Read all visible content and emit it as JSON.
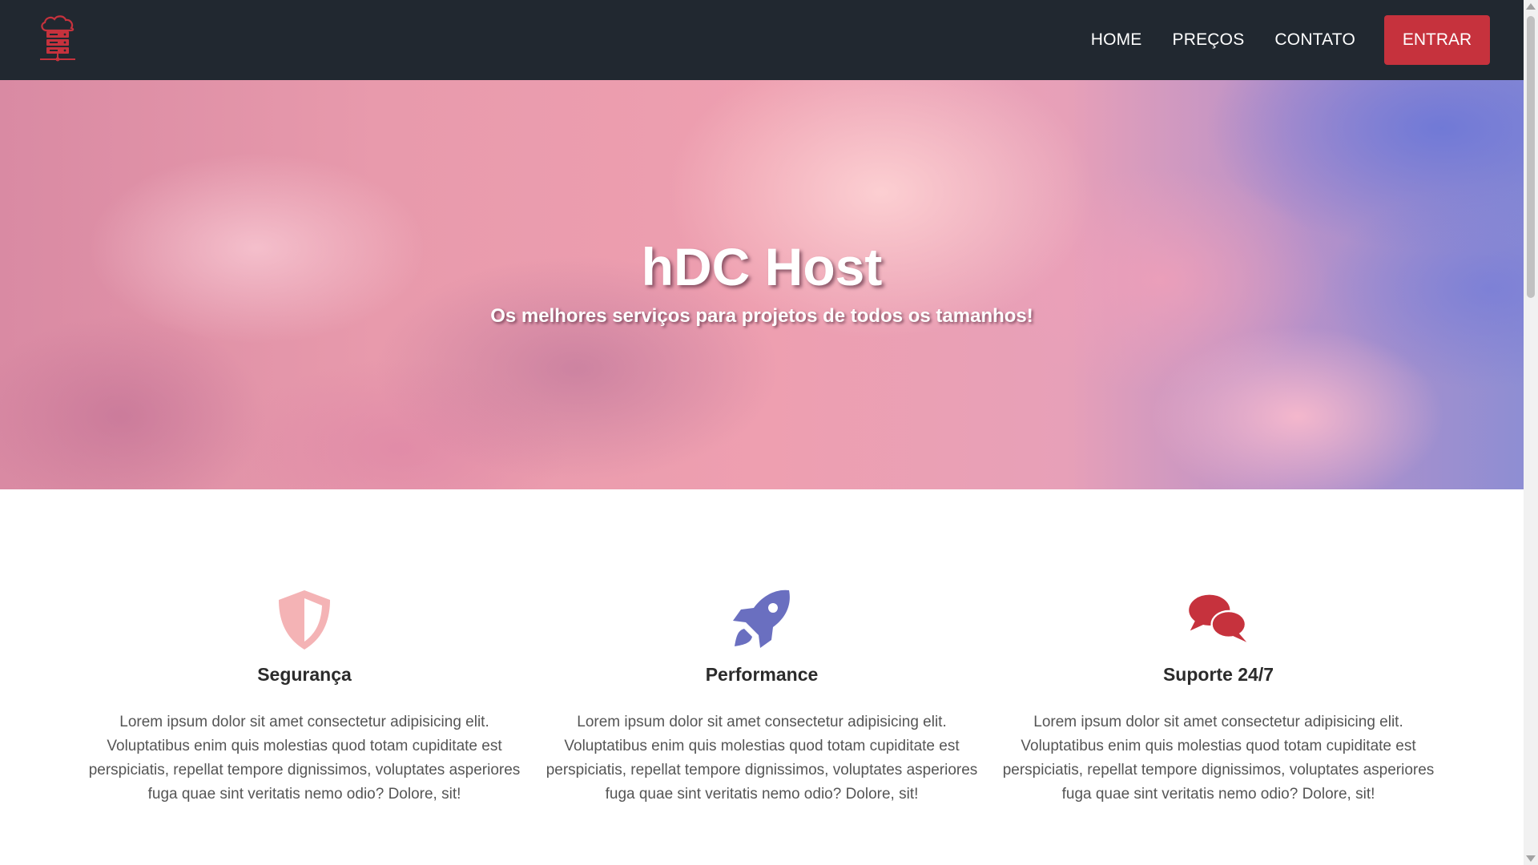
{
  "navbar": {
    "logo_icon": "server-cloud-icon",
    "links": [
      {
        "label": "HOME"
      },
      {
        "label": "PREÇOS"
      },
      {
        "label": "CONTATO"
      }
    ],
    "cta_label": "ENTRAR"
  },
  "hero": {
    "title": "hDC Host",
    "subtitle": "Os melhores serviços para projetos de todos os tamanhos!"
  },
  "features": [
    {
      "icon": "shield-icon",
      "title": "Segurança",
      "text": "Lorem ipsum dolor sit amet consectetur adipisicing elit. Voluptatibus enim quis molestias quod totam cupiditate est perspiciatis, repellat tempore dignissimos, voluptates asperiores fuga quae sint veritatis nemo odio? Dolore, sit!"
    },
    {
      "icon": "rocket-icon",
      "title": "Performance",
      "text": "Lorem ipsum dolor sit amet consectetur adipisicing elit. Voluptatibus enim quis molestias quod totam cupiditate est perspiciatis, repellat tempore dignissimos, voluptates asperiores fuga quae sint veritatis nemo odio? Dolore, sit!"
    },
    {
      "icon": "chat-bubbles-icon",
      "title": "Suporte 24/7",
      "text": "Lorem ipsum dolor sit amet consectetur adipisicing elit. Voluptatibus enim quis molestias quod totam cupiditate est perspiciatis, repellat tempore dignissimos, voluptates asperiores fuga quae sint veritatis nemo odio? Dolore, sit!"
    }
  ],
  "colors": {
    "navbar_bg": "#212830",
    "accent_red": "#c6323d",
    "shield_pink": "#f4b3b5",
    "rocket_purple": "#6a6fc0",
    "chat_red": "#c6323d"
  }
}
